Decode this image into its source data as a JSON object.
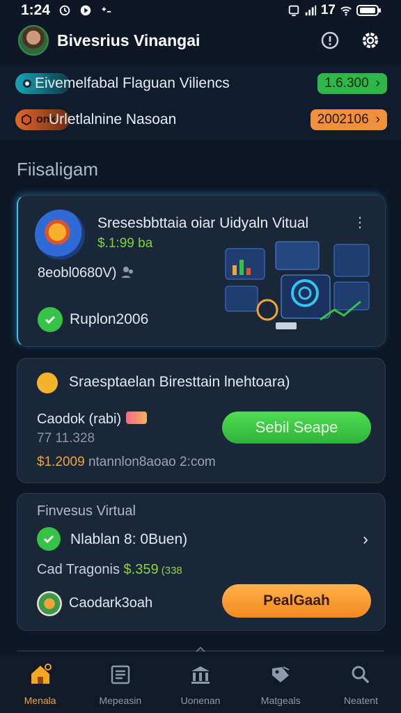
{
  "status_bar": {
    "time": "1:24",
    "right_text": "17"
  },
  "header": {
    "title": "Bivesrius Vinangai",
    "info_icon": "info-icon",
    "settings_icon": "gear-icon"
  },
  "top_rows": [
    {
      "pill_text": "",
      "text": "Eivemelfabal Flaguan Viliencs",
      "badge": "1.6.300",
      "badge_color": "#2fb54a"
    },
    {
      "pill_text": "onk",
      "text": "Urletlalnine Nasoan",
      "badge": "2002106",
      "badge_color": "#f0903a"
    }
  ],
  "section_title": "Fiisaligam",
  "card1": {
    "title": "Sresesbbttaia oiar Uidyaln Vitual",
    "price": "$.1:99 ba",
    "code": "8eobl0680V)",
    "status": "Ruplon2006"
  },
  "card2": {
    "title": "Sraesptaelan Biresttain lnehtoara)",
    "label": "Caodok (rabi)",
    "number": "77 11.328",
    "footer_amount": "$1.2009",
    "footer_text": " ntannlon8aoao 2:com",
    "button": "Sebil Seape"
  },
  "card3": {
    "title": "Finvesus Virtual",
    "row": "Nlablan 8: 0Buen)",
    "trade_label": "Cad Tragonis ",
    "trade_amount": "$.359",
    "trade_small": " (338",
    "name": "Caodark3oah",
    "button": "PealGaah"
  },
  "nav": [
    {
      "label": "Menala",
      "icon": "home-icon",
      "active": true
    },
    {
      "label": "Mepeasin",
      "icon": "newspaper-icon",
      "active": false
    },
    {
      "label": "Uonenan",
      "icon": "bank-icon",
      "active": false
    },
    {
      "label": "Matgeals",
      "icon": "tag-icon",
      "active": false
    },
    {
      "label": "Neatent",
      "icon": "search-icon",
      "active": false
    }
  ],
  "colors": {
    "background": "#0d1726",
    "card": "#1a2738",
    "accent_green": "#36c246",
    "accent_orange": "#f0903a",
    "accent_cyan": "#31c5f0"
  }
}
